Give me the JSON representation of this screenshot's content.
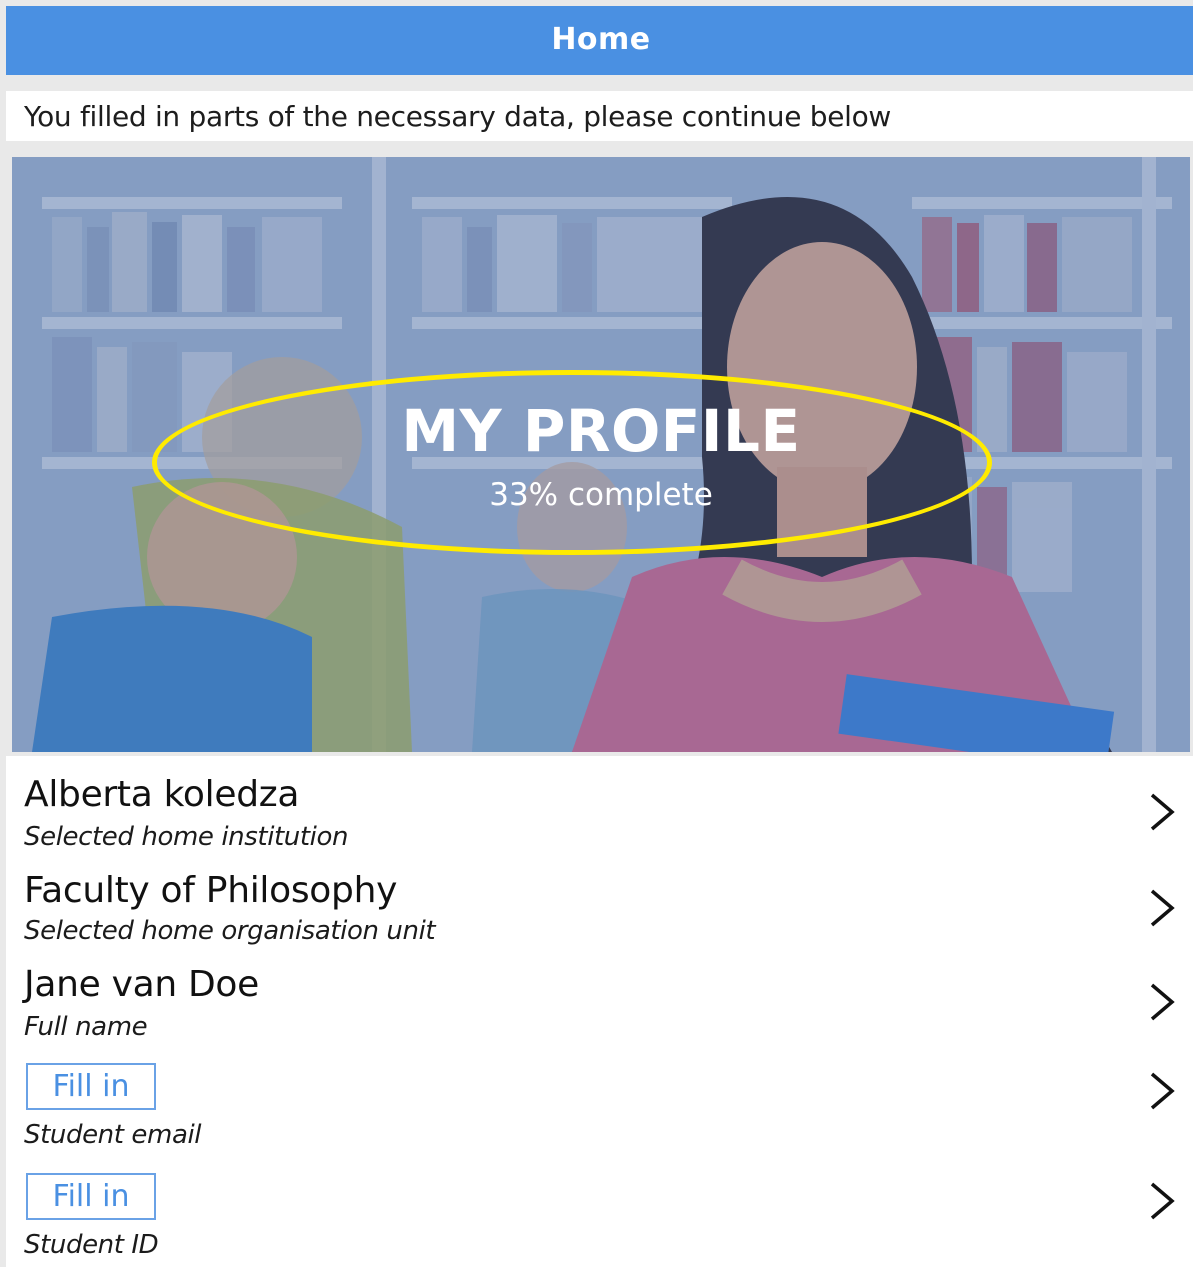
{
  "header": {
    "title": "Home"
  },
  "notice": {
    "text": "You filled in parts of the necessary data, please continue below"
  },
  "hero": {
    "title": "MY PROFILE",
    "completion_text": "33% complete",
    "completion_percent": 33,
    "highlight_color": "#ffeb00"
  },
  "profile_items": [
    {
      "value": "Alberta koledza",
      "caption": "Selected home institution",
      "filled": true
    },
    {
      "value": "Faculty of Philosophy",
      "caption": "Selected home organisation unit",
      "filled": true
    },
    {
      "value": "Jane van Doe",
      "caption": "Full name",
      "filled": true
    },
    {
      "value": "",
      "caption": "Student email",
      "filled": false,
      "button_label": "Fill in"
    },
    {
      "value": "",
      "caption": "Student ID",
      "filled": false,
      "button_label": "Fill in"
    }
  ],
  "colors": {
    "accent": "#4a90e2",
    "header_text": "#ffffff"
  },
  "icons": {
    "chevron": "chevron-right-icon"
  }
}
